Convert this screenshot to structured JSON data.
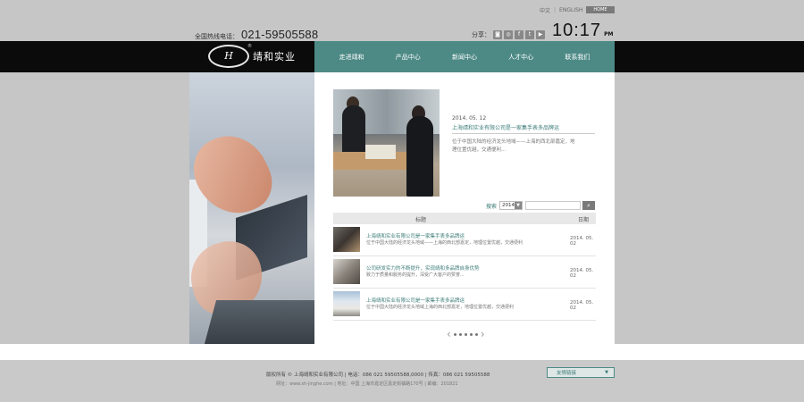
{
  "header": {
    "lang_cn": "中文",
    "lang_en": "ENGLISH",
    "home_label": "HOME",
    "hotline_label": "全国热线电话：",
    "hotline_number": "021-59505588",
    "share_label": "分享：",
    "share_icons": [
      "share-icon",
      "qq-icon",
      "facebook-icon",
      "twitter-icon",
      "youtube-icon"
    ],
    "time": "10:17",
    "ampm": "PM"
  },
  "brand": {
    "logo_mark": "H",
    "registered": "®",
    "name": "靖和实业"
  },
  "nav": {
    "items": [
      "走进靖和",
      "产品中心",
      "新闻中心",
      "人才中心",
      "联系我们"
    ]
  },
  "featured": {
    "date": "2014. 05. 12",
    "title": "上海靖和实业有限公司是一家集手表多品牌运",
    "desc": "位于中国大陆的经济龙头地域——上海的西北部嘉定，地理位置优越，交通便利..."
  },
  "search": {
    "label": "搜索",
    "year": "2014",
    "button_icon": "search-icon"
  },
  "table": {
    "col_title": "标题",
    "col_date": "日期",
    "rows": [
      {
        "title": "上海靖和实业有限公司是一家集手表多品牌运",
        "desc": "位于中国大陆的经济龙头地域——上海的西北部嘉定，地理位置优越，交通便利",
        "date": "2014. 05. 02"
      },
      {
        "title": "公司研发实力的不断提升，实现靖和多品牌自身优势",
        "desc": "致力于质量和服务的提升，深受广大客户的赞誉...",
        "date": "2014. 05. 02"
      },
      {
        "title": "上海靖和实业有限公司是一家集手表多品牌运",
        "desc": "位于中国大陆的经济龙头地域上海的西北部嘉定，地理位置优越，交通便利",
        "date": "2014. 05. 02"
      }
    ]
  },
  "pager": {
    "prev": "‹",
    "next": "›",
    "pages": 5
  },
  "footer": {
    "copyright": "版权所有 © 上海靖和实业有限公司 | 电话：086 021 59505588,0000 | 传真：086 021 59505588",
    "address": "网址：www.sh-jinghe.com | 地址：中国 上海市嘉定区嘉定街镇路170号 | 邮编：201821",
    "links_label": "友情链接",
    "links_arrow": "▼"
  },
  "colors": {
    "accent": "#4d8a86",
    "nav_bg": "#0b0b0b",
    "page_bg": "#c6c6c6"
  }
}
